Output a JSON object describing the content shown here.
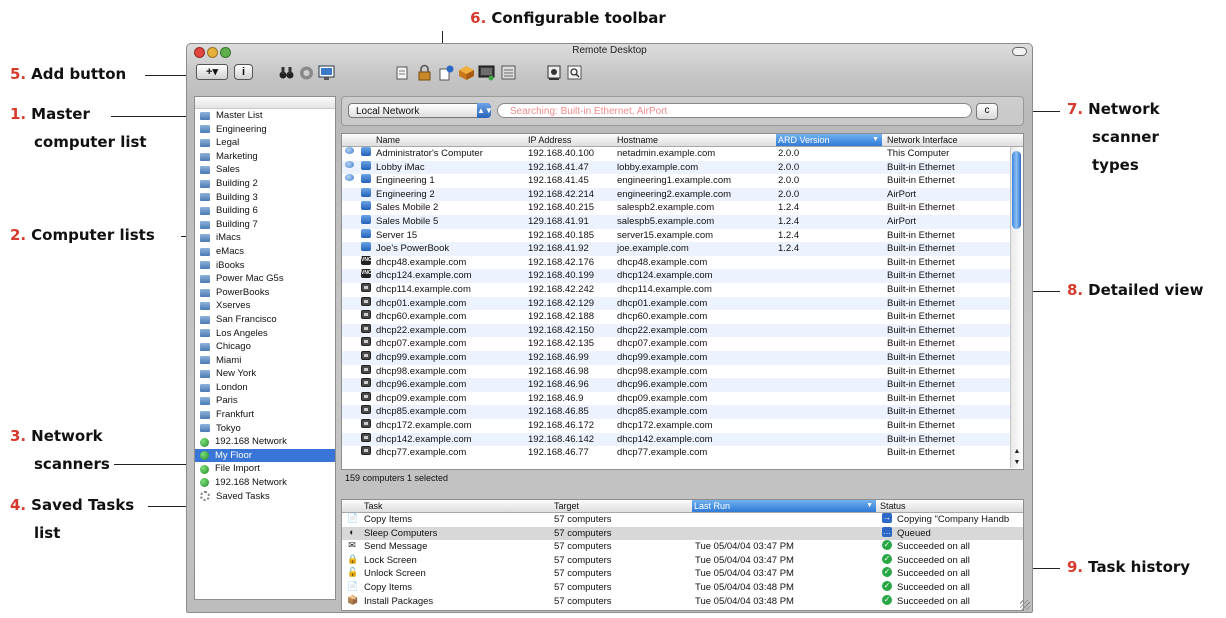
{
  "window": {
    "title": "Remote Desktop"
  },
  "annotations": [
    {
      "num": "6.",
      "text": "Configurable toolbar"
    },
    {
      "num": "5.",
      "text": "Add button"
    },
    {
      "num": "1.",
      "text": "Master",
      "text2": "computer list"
    },
    {
      "num": "2.",
      "text": "Computer lists"
    },
    {
      "num": "3.",
      "text": "Network",
      "text2": "scanners"
    },
    {
      "num": "4.",
      "text": "Saved Tasks",
      "text2": "list"
    },
    {
      "num": "7.",
      "text": "Network",
      "text2": "scanner",
      "text3": "types"
    },
    {
      "num": "8.",
      "text": "Detailed view"
    },
    {
      "num": "9.",
      "text": "Task history"
    }
  ],
  "toolbar": {
    "add_button": "+▾",
    "info_button": "i",
    "icons": [
      "binoculars-icon",
      "observe-icon",
      "control-icon",
      "message-icon",
      "lock-icon",
      "copy-icon",
      "install-icon",
      "unix-icon",
      "report-icon",
      "reports-icon",
      "spotlight-icon"
    ]
  },
  "sidebar": {
    "items": [
      {
        "label": "Master List",
        "type": "list"
      },
      {
        "label": "Engineering",
        "type": "list"
      },
      {
        "label": "Legal",
        "type": "list"
      },
      {
        "label": "Marketing",
        "type": "list"
      },
      {
        "label": "Sales",
        "type": "list"
      },
      {
        "label": "Building 2",
        "type": "list"
      },
      {
        "label": "Building 3",
        "type": "list"
      },
      {
        "label": "Building 6",
        "type": "list"
      },
      {
        "label": "Building 7",
        "type": "list"
      },
      {
        "label": "iMacs",
        "type": "list"
      },
      {
        "label": "eMacs",
        "type": "list"
      },
      {
        "label": "iBooks",
        "type": "list"
      },
      {
        "label": "Power Mac G5s",
        "type": "list"
      },
      {
        "label": "PowerBooks",
        "type": "list"
      },
      {
        "label": "Xserves",
        "type": "list"
      },
      {
        "label": "San Francisco",
        "type": "list"
      },
      {
        "label": "Los Angeles",
        "type": "list"
      },
      {
        "label": "Chicago",
        "type": "list"
      },
      {
        "label": "Miami",
        "type": "list"
      },
      {
        "label": "New York",
        "type": "list"
      },
      {
        "label": "London",
        "type": "list"
      },
      {
        "label": "Paris",
        "type": "list"
      },
      {
        "label": "Frankfurt",
        "type": "list"
      },
      {
        "label": "Tokyo",
        "type": "list"
      },
      {
        "label": "192.168 Network",
        "type": "scan"
      },
      {
        "label": "My Floor",
        "type": "scan",
        "selected": true
      },
      {
        "label": "File Import",
        "type": "scan"
      },
      {
        "label": "192.168 Network",
        "type": "scan"
      },
      {
        "label": "Saved Tasks",
        "type": "gear"
      }
    ]
  },
  "scanner": {
    "selected": "Local Network",
    "search_text": "Searching: Built-in Ethernet, AirPort",
    "refresh_label": "c"
  },
  "computers": {
    "columns": [
      "Name",
      "IP Address",
      "Hostname",
      "ARD Version",
      "Network Interface"
    ],
    "sorted_column": "ARD Version",
    "rows": [
      {
        "name": "Administrator's Computer",
        "ip": "192.168.40.100",
        "host": "netadmin.example.com",
        "ard": "2.0.0",
        "iface": "This Computer",
        "icon": "ard",
        "observed": true
      },
      {
        "name": "Lobby iMac",
        "ip": "192.168.41.47",
        "host": "lobby.example.com",
        "ard": "2.0.0",
        "iface": "Built-in Ethernet",
        "icon": "ard",
        "observed": true
      },
      {
        "name": "Engineering 1",
        "ip": "192.168.41.45",
        "host": "engineering1.example.com",
        "ard": "2.0.0",
        "iface": "Built-in Ethernet",
        "icon": "ard",
        "observed": true
      },
      {
        "name": "Engineering 2",
        "ip": "192.168.42.214",
        "host": "engineering2.example.com",
        "ard": "2.0.0",
        "iface": "AirPort",
        "icon": "ard",
        "observed": false
      },
      {
        "name": "Sales Mobile 2",
        "ip": "192.168.40.215",
        "host": "salespb2.example.com",
        "ard": "1.2.4",
        "iface": "Built-in Ethernet",
        "icon": "ard",
        "observed": false
      },
      {
        "name": "Sales Mobile 5",
        "ip": "129.168.41.91",
        "host": "salespb5.example.com",
        "ard": "1.2.4",
        "iface": "AirPort",
        "icon": "ard",
        "observed": false
      },
      {
        "name": "Server 15",
        "ip": "192.168.40.185",
        "host": "server15.example.com",
        "ard": "1.2.4",
        "iface": "Built-in Ethernet",
        "icon": "ard",
        "observed": false
      },
      {
        "name": "Joe's PowerBook",
        "ip": "192.168.41.92",
        "host": "joe.example.com",
        "ard": "1.2.4",
        "iface": "Built-in Ethernet",
        "icon": "ard",
        "observed": false
      },
      {
        "name": "dhcp48.example.com",
        "ip": "192.168.42.176",
        "host": "dhcp48.example.com",
        "ard": "",
        "iface": "Built-in Ethernet",
        "icon": "vnc",
        "observed": false
      },
      {
        "name": "dhcp124.example.com",
        "ip": "192.168.40.199",
        "host": "dhcp124.example.com",
        "ard": "",
        "iface": "Built-in Ethernet",
        "icon": "vnc",
        "observed": false
      },
      {
        "name": "dhcp114.example.com",
        "ip": "192.168.42.242",
        "host": "dhcp114.example.com",
        "ard": "",
        "iface": "Built-in Ethernet",
        "icon": "gen",
        "observed": false
      },
      {
        "name": "dhcp01.example.com",
        "ip": "192.168.42.129",
        "host": "dhcp01.example.com",
        "ard": "",
        "iface": "Built-in Ethernet",
        "icon": "gen",
        "observed": false
      },
      {
        "name": "dhcp60.example.com",
        "ip": "192.168.42.188",
        "host": "dhcp60.example.com",
        "ard": "",
        "iface": "Built-in Ethernet",
        "icon": "gen",
        "observed": false
      },
      {
        "name": "dhcp22.example.com",
        "ip": "192.168.42.150",
        "host": "dhcp22.example.com",
        "ard": "",
        "iface": "Built-in Ethernet",
        "icon": "gen",
        "observed": false
      },
      {
        "name": "dhcp07.example.com",
        "ip": "192.168.42.135",
        "host": "dhcp07.example.com",
        "ard": "",
        "iface": "Built-in Ethernet",
        "icon": "gen",
        "observed": false
      },
      {
        "name": "dhcp99.example.com",
        "ip": "192.168.46.99",
        "host": "dhcp99.example.com",
        "ard": "",
        "iface": "Built-in Ethernet",
        "icon": "gen",
        "observed": false
      },
      {
        "name": "dhcp98.example.com",
        "ip": "192.168.46.98",
        "host": "dhcp98.example.com",
        "ard": "",
        "iface": "Built-in Ethernet",
        "icon": "gen",
        "observed": false
      },
      {
        "name": "dhcp96.example.com",
        "ip": "192.168.46.96",
        "host": "dhcp96.example.com",
        "ard": "",
        "iface": "Built-in Ethernet",
        "icon": "gen",
        "observed": false
      },
      {
        "name": "dhcp09.example.com",
        "ip": "192.168.46.9",
        "host": "dhcp09.example.com",
        "ard": "",
        "iface": "Built-in Ethernet",
        "icon": "gen",
        "observed": false
      },
      {
        "name": "dhcp85.example.com",
        "ip": "192.168.46.85",
        "host": "dhcp85.example.com",
        "ard": "",
        "iface": "Built-in Ethernet",
        "icon": "gen",
        "observed": false
      },
      {
        "name": "dhcp172.example.com",
        "ip": "192.168.46.172",
        "host": "dhcp172.example.com",
        "ard": "",
        "iface": "Built-in Ethernet",
        "icon": "gen",
        "observed": false
      },
      {
        "name": "dhcp142.example.com",
        "ip": "192.168.46.142",
        "host": "dhcp142.example.com",
        "ard": "",
        "iface": "Built-in Ethernet",
        "icon": "gen",
        "observed": false
      },
      {
        "name": "dhcp77.example.com",
        "ip": "192.168.46.77",
        "host": "dhcp77.example.com",
        "ard": "",
        "iface": "Built-in Ethernet",
        "icon": "gen",
        "observed": false
      }
    ]
  },
  "status_bar": "159 computers   1 selected",
  "tasks": {
    "columns": [
      "Task",
      "Target",
      "Last Run",
      "Status"
    ],
    "sorted_column": "Last Run",
    "rows": [
      {
        "task": "Copy Items",
        "target": "57 computers",
        "last_run": "",
        "status": "Copying \"Company Handb",
        "icon": "copy",
        "status_icon": "copy"
      },
      {
        "task": "Sleep Computers",
        "target": "57 computers",
        "last_run": "",
        "status": "Queued",
        "icon": "sleep",
        "status_icon": "queue",
        "highlight": true
      },
      {
        "task": "Send Message",
        "target": "57 computers",
        "last_run": "Tue 05/04/04 03:47 PM",
        "status": "Succeeded on all",
        "icon": "message",
        "status_icon": "ok"
      },
      {
        "task": "Lock Screen",
        "target": "57 computers",
        "last_run": "Tue 05/04/04 03:47 PM",
        "status": "Succeeded on all",
        "icon": "lock",
        "status_icon": "ok"
      },
      {
        "task": "Unlock Screen",
        "target": "57 computers",
        "last_run": "Tue 05/04/04 03:47 PM",
        "status": "Succeeded on all",
        "icon": "unlock",
        "status_icon": "ok"
      },
      {
        "task": "Copy Items",
        "target": "57 computers",
        "last_run": "Tue 05/04/04 03:48 PM",
        "status": "Succeeded on all",
        "icon": "copy",
        "status_icon": "ok"
      },
      {
        "task": "Install Packages",
        "target": "57 computers",
        "last_run": "Tue 05/04/04 03:48 PM",
        "status": "Succeeded on all",
        "icon": "install",
        "status_icon": "ok"
      }
    ]
  },
  "colors": {
    "annotation_number": "#d63a2c",
    "selection": "#3875d7",
    "sort_header": "#2f7ad6",
    "row_alt": "#edf3fe"
  }
}
